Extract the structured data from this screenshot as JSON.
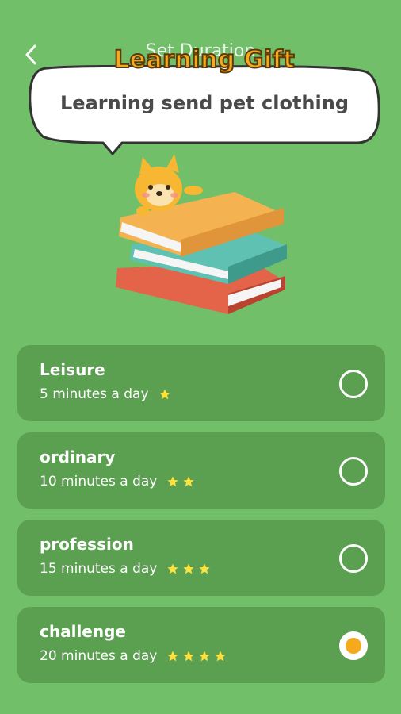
{
  "header": {
    "back_icon": "chevron-left-icon",
    "title": "Set Duration"
  },
  "bubble": {
    "heading": "Learning Gift",
    "text": "Learning send pet clothing"
  },
  "colors": {
    "background": "#72bf6a",
    "card": "#5b9f50",
    "accent": "#f5a91d",
    "star": "#ffe13a"
  },
  "options": [
    {
      "name": "Leisure",
      "desc": "5 minutes a day",
      "stars": 1,
      "selected": false
    },
    {
      "name": "ordinary",
      "desc": "10 minutes a day",
      "stars": 2,
      "selected": false
    },
    {
      "name": "profession",
      "desc": "15 minutes a day",
      "stars": 3,
      "selected": false
    },
    {
      "name": "challenge",
      "desc": "20 minutes a day",
      "stars": 4,
      "selected": true
    }
  ]
}
